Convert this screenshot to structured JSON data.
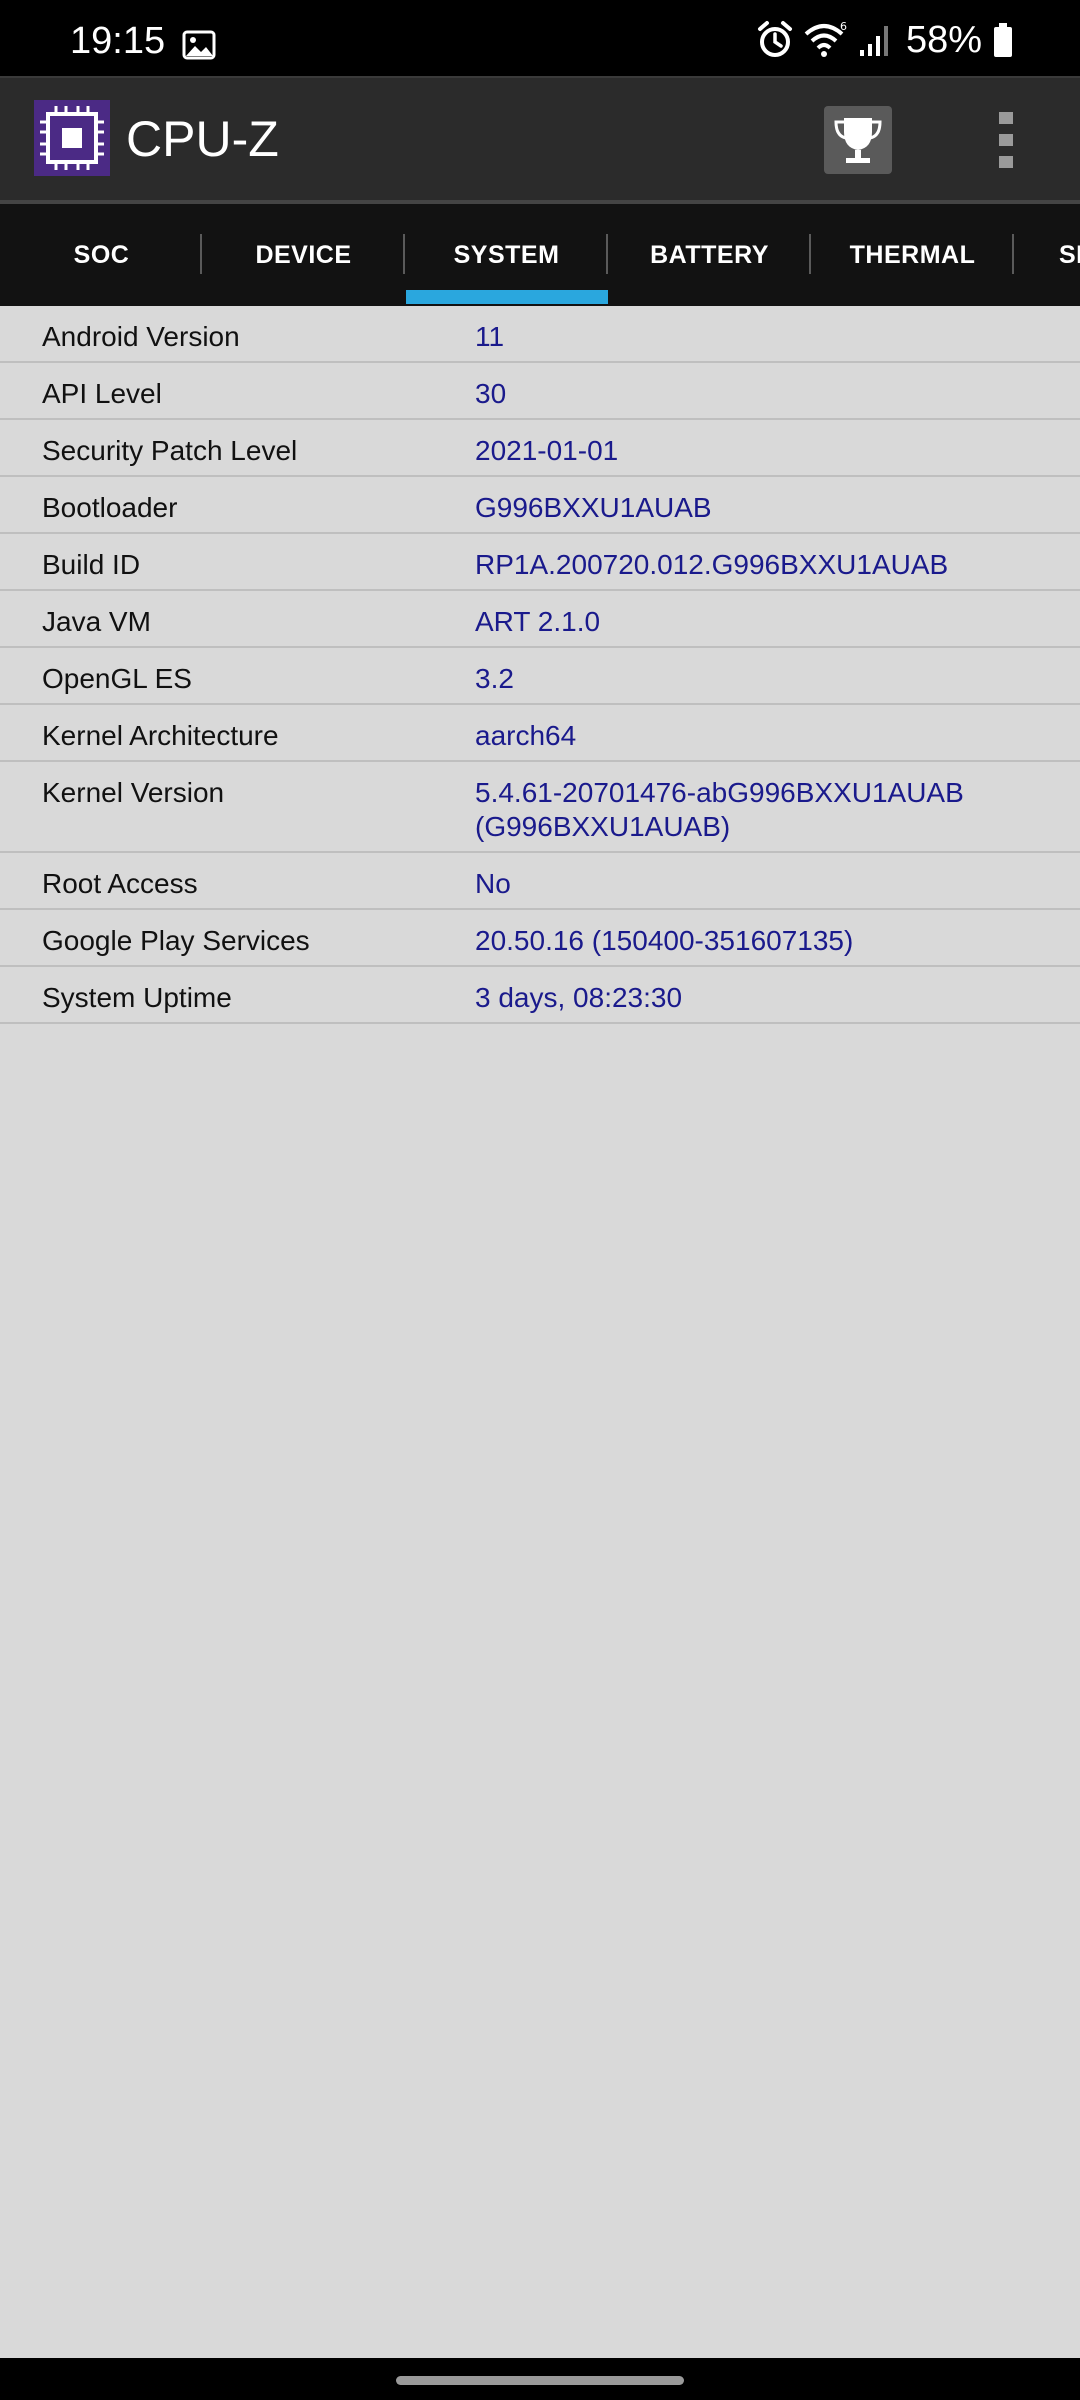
{
  "status_bar": {
    "time": "19:15",
    "battery_percent": "58%",
    "icons": [
      "gallery-icon",
      "alarm-icon",
      "wifi-icon",
      "signal-icon",
      "battery-icon"
    ]
  },
  "app_bar": {
    "title": "CPU-Z",
    "icons": [
      "cpu-logo-icon",
      "trophy-icon",
      "more-vert-icon"
    ]
  },
  "tabs": [
    {
      "label": "SOC"
    },
    {
      "label": "DEVICE"
    },
    {
      "label": "SYSTEM",
      "selected": true
    },
    {
      "label": "BATTERY"
    },
    {
      "label": "THERMAL"
    },
    {
      "label": "SE"
    }
  ],
  "system_info": [
    {
      "label": "Android Version",
      "value": "11"
    },
    {
      "label": "API Level",
      "value": "30"
    },
    {
      "label": "Security Patch Level",
      "value": "2021-01-01"
    },
    {
      "label": "Bootloader",
      "value": "G996BXXU1AUAB"
    },
    {
      "label": "Build ID",
      "value": "RP1A.200720.012.G996BXXU1AUAB"
    },
    {
      "label": "Java VM",
      "value": "ART 2.1.0"
    },
    {
      "label": "OpenGL ES",
      "value": "3.2"
    },
    {
      "label": "Kernel Architecture",
      "value": "aarch64"
    },
    {
      "label": "Kernel Version",
      "value": "5.4.61-20701476-abG996BXXU1AUAB (G996BXXU1AUAB)"
    },
    {
      "label": "Root Access",
      "value": "No"
    },
    {
      "label": "Google Play Services",
      "value": "20.50.16 (150400-351607135)"
    },
    {
      "label": "System Uptime",
      "value": "3 days, 08:23:30"
    }
  ],
  "colors": {
    "accent": "#2aa7de",
    "value_text": "#1a1a8c",
    "background": "#d9d9d9",
    "app_bar": "#2b2b2b",
    "tab_bar": "#121212"
  }
}
